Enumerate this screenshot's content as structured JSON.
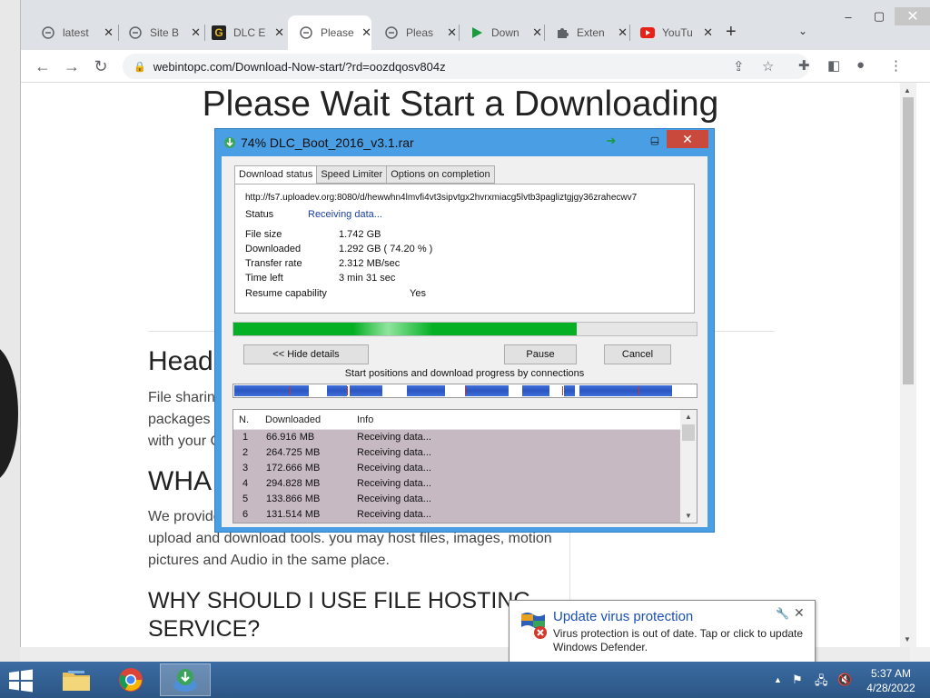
{
  "browser": {
    "tabs": [
      {
        "title": "latest",
        "icon": "globe-icon"
      },
      {
        "title": "Site B",
        "icon": "globe-icon"
      },
      {
        "title": "DLC E",
        "icon": "g-icon"
      },
      {
        "title": "Please",
        "icon": "globe-icon"
      },
      {
        "title": "Pleas",
        "icon": "globe-icon"
      },
      {
        "title": "Down",
        "icon": "play-icon"
      },
      {
        "title": "Exten",
        "icon": "puzzle-icon"
      },
      {
        "title": "YouTu",
        "icon": "youtube-icon"
      }
    ],
    "url": "webintopc.com/Download-Now-start/?rd=oozdqosv804z"
  },
  "page": {
    "heading": "Please Wait Start a Downloading",
    "section1_title": "Head",
    "section1_lines": [
      "File sharing",
      "packages t",
      "with your C"
    ],
    "section2_title": "WHA",
    "section2_lines": [
      "We provide",
      "upload and download tools. you may host files, images, motion",
      "pictures and Audio in the same place."
    ],
    "section3_title": "WHY SHOULD I USE FILE HOSTING SERVICE?"
  },
  "idm": {
    "title": "74% DLC_Boot_2016_v3.1.rar",
    "tabs": [
      "Download status",
      "Speed Limiter",
      "Options on completion"
    ],
    "url": "http://fs7.uploadev.org:8080/d/hewwhn4lmvfi4vt3sipvtgx2hvrxmiacg5lvtb3pagliztgjgy36zrahecwv7",
    "status_label": "Status",
    "status_value": "Receiving data...",
    "file_size_label": "File size",
    "file_size_value": "1.742  GB",
    "downloaded_label": "Downloaded",
    "downloaded_value": "1.292  GB  ( 74.20 % )",
    "transfer_label": "Transfer rate",
    "transfer_value": "2.312  MB/sec",
    "time_left_label": "Time left",
    "time_left_value": "3 min 31 sec",
    "resume_label": "Resume capability",
    "resume_value": "Yes",
    "progress": 0.742,
    "hide_details": "<< Hide details",
    "pause": "Pause",
    "cancel": "Cancel",
    "connections_label": "Start positions and download progress by connections",
    "list_headers": [
      "N.",
      "Downloaded",
      "Info"
    ],
    "connections": [
      {
        "n": "1",
        "downloaded": "66.916  MB",
        "info": "Receiving data..."
      },
      {
        "n": "2",
        "downloaded": "264.725  MB",
        "info": "Receiving data..."
      },
      {
        "n": "3",
        "downloaded": "172.666  MB",
        "info": "Receiving data..."
      },
      {
        "n": "4",
        "downloaded": "294.828  MB",
        "info": "Receiving data..."
      },
      {
        "n": "5",
        "downloaded": "133.866  MB",
        "info": "Receiving data..."
      },
      {
        "n": "6",
        "downloaded": "131.514  MB",
        "info": "Receiving data..."
      }
    ]
  },
  "notification": {
    "title": "Update virus protection",
    "message": "Virus protection is out of date. Tap or click to update Windows Defender."
  },
  "taskbar": {
    "time": "5:37 AM",
    "date": "4/28/2022"
  },
  "colors": {
    "idm_frame": "#4a9ee4",
    "progress_green": "#06b025",
    "connection_blue": "#2b56c2",
    "notification_title": "#1a4fb3"
  }
}
